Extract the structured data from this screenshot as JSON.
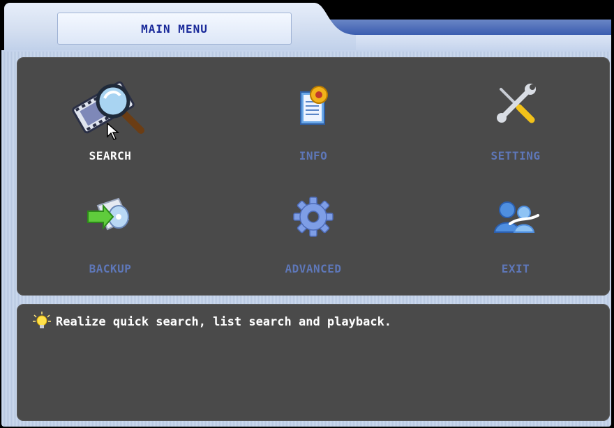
{
  "window": {
    "title": "MAIN MENU"
  },
  "menu": {
    "items": [
      {
        "label": "SEARCH",
        "icon": "search-film-icon",
        "selected": true
      },
      {
        "label": "INFO",
        "icon": "info-document-gear-icon",
        "selected": false
      },
      {
        "label": "SETTING",
        "icon": "tools-icon",
        "selected": false
      },
      {
        "label": "BACKUP",
        "icon": "backup-disc-icon",
        "selected": false
      },
      {
        "label": "ADVANCED",
        "icon": "gear-icon",
        "selected": false
      },
      {
        "label": "EXIT",
        "icon": "exit-user-icon",
        "selected": false
      }
    ]
  },
  "help": {
    "icon": "lightbulb-icon",
    "text": "Realize quick search, list search and playback."
  },
  "colors": {
    "title_text": "#1a2a9a",
    "panel_bg": "#4a4a4a",
    "label_active": "#ffffff",
    "label_inactive": "#5e77b8"
  }
}
